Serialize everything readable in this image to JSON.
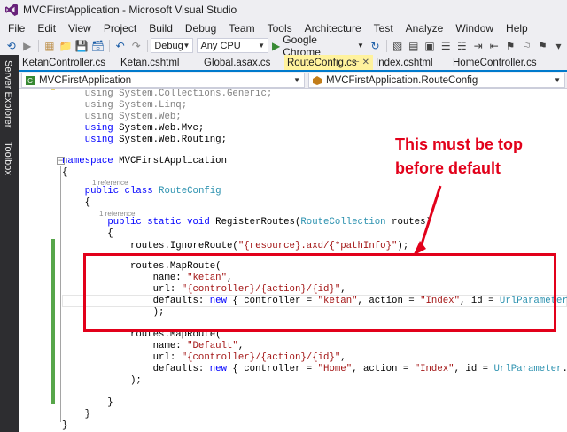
{
  "window": {
    "title": "MVCFirstApplication - Microsoft Visual Studio"
  },
  "menu": {
    "items": [
      "File",
      "Edit",
      "View",
      "Project",
      "Build",
      "Debug",
      "Team",
      "Tools",
      "Architecture",
      "Test",
      "Analyze",
      "Window",
      "Help"
    ]
  },
  "toolbar": {
    "configuration": "Debug",
    "platform": "Any CPU",
    "run_target": "Google Chrome"
  },
  "side_panel": {
    "server_explorer": "Server Explorer",
    "toolbox": "Toolbox"
  },
  "tabs": [
    {
      "label": "KetanController.cs",
      "active": false
    },
    {
      "label": "Ketan.cshtml",
      "active": false
    },
    {
      "label": "Global.asax.cs",
      "active": false
    },
    {
      "label": "RouteConfig.cs",
      "active": true
    },
    {
      "label": "Index.cshtml",
      "active": false
    },
    {
      "label": "HomeController.cs",
      "active": false
    }
  ],
  "navbar": {
    "project": "MVCFirstApplication",
    "class": "MVCFirstApplication.RouteConfig"
  },
  "code": {
    "using_collections": "System.Collections.Generic;",
    "using_linq": "System.Linq;",
    "using_web": "System.Web;",
    "using_mvc": "System.Web.Mvc;",
    "using_routing": "System.Web.Routing;",
    "namespace_name": "MVCFirstApplication",
    "class_name": "RouteConfig",
    "method_name": "RegisterRoutes",
    "param_type": "RouteCollection",
    "param_name": "routes",
    "lens_class": "1 reference",
    "lens_method": "1 reference",
    "ignore_route": "\"{resource}.axd/{*pathInfo}\"",
    "route1": {
      "name": "\"ketan\"",
      "url": "\"{controller}/{action}/{id}\"",
      "controller": "\"ketan\"",
      "action": "\"Index\""
    },
    "route2": {
      "name": "\"Default\"",
      "url": "\"{controller}/{action}/{id}\"",
      "controller": "\"Home\"",
      "action": "\"Index\""
    }
  },
  "annotation": {
    "line1": "This must be top",
    "line2": "before default"
  },
  "colors": {
    "annotation_red": "#e2001a",
    "keyword_blue": "#0000ff",
    "type_teal": "#2b91af",
    "string_red": "#a31515",
    "accent_blue": "#007acc",
    "active_tab_yellow": "#fff29d"
  }
}
